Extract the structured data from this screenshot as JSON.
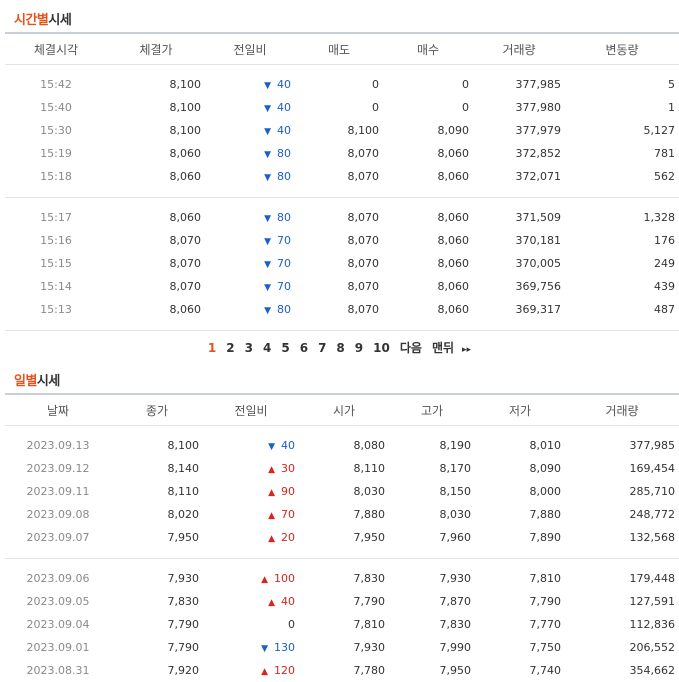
{
  "time_section": {
    "title_accent": "시간별",
    "title_rest": "시세",
    "headers": [
      "체결시각",
      "체결가",
      "전일비",
      "매도",
      "매수",
      "거래량",
      "변동량"
    ],
    "group1": [
      {
        "time": "15:42",
        "price": "8,100",
        "dir": "down",
        "diff": "40",
        "ask": "0",
        "bid": "0",
        "volume": "377,985",
        "change": "5"
      },
      {
        "time": "15:40",
        "price": "8,100",
        "dir": "down",
        "diff": "40",
        "ask": "0",
        "bid": "0",
        "volume": "377,980",
        "change": "1"
      },
      {
        "time": "15:30",
        "price": "8,100",
        "dir": "down",
        "diff": "40",
        "ask": "8,100",
        "bid": "8,090",
        "volume": "377,979",
        "change": "5,127"
      },
      {
        "time": "15:19",
        "price": "8,060",
        "dir": "down",
        "diff": "80",
        "ask": "8,070",
        "bid": "8,060",
        "volume": "372,852",
        "change": "781"
      },
      {
        "time": "15:18",
        "price": "8,060",
        "dir": "down",
        "diff": "80",
        "ask": "8,070",
        "bid": "8,060",
        "volume": "372,071",
        "change": "562"
      }
    ],
    "group2": [
      {
        "time": "15:17",
        "price": "8,060",
        "dir": "down",
        "diff": "80",
        "ask": "8,070",
        "bid": "8,060",
        "volume": "371,509",
        "change": "1,328"
      },
      {
        "time": "15:16",
        "price": "8,070",
        "dir": "down",
        "diff": "70",
        "ask": "8,070",
        "bid": "8,060",
        "volume": "370,181",
        "change": "176"
      },
      {
        "time": "15:15",
        "price": "8,070",
        "dir": "down",
        "diff": "70",
        "ask": "8,070",
        "bid": "8,060",
        "volume": "370,005",
        "change": "249"
      },
      {
        "time": "15:14",
        "price": "8,070",
        "dir": "down",
        "diff": "70",
        "ask": "8,070",
        "bid": "8,060",
        "volume": "369,756",
        "change": "439"
      },
      {
        "time": "15:13",
        "price": "8,060",
        "dir": "down",
        "diff": "80",
        "ask": "8,070",
        "bid": "8,060",
        "volume": "369,317",
        "change": "487"
      }
    ]
  },
  "pager": {
    "pages": [
      "1",
      "2",
      "3",
      "4",
      "5",
      "6",
      "7",
      "8",
      "9",
      "10"
    ],
    "current": "1",
    "next_label": "다음",
    "last_label": "맨뒤",
    "last_icon": "double-chevron-right"
  },
  "daily_section": {
    "title_accent": "일별",
    "title_rest": "시세",
    "headers": [
      "날짜",
      "종가",
      "전일비",
      "시가",
      "고가",
      "저가",
      "거래량"
    ],
    "group1": [
      {
        "date": "2023.09.13",
        "close": "8,100",
        "dir": "down",
        "diff": "40",
        "open": "8,080",
        "high": "8,190",
        "low": "8,010",
        "volume": "377,985"
      },
      {
        "date": "2023.09.12",
        "close": "8,140",
        "dir": "up",
        "diff": "30",
        "open": "8,110",
        "high": "8,170",
        "low": "8,090",
        "volume": "169,454"
      },
      {
        "date": "2023.09.11",
        "close": "8,110",
        "dir": "up",
        "diff": "90",
        "open": "8,030",
        "high": "8,150",
        "low": "8,000",
        "volume": "285,710"
      },
      {
        "date": "2023.09.08",
        "close": "8,020",
        "dir": "up",
        "diff": "70",
        "open": "7,880",
        "high": "8,030",
        "low": "7,880",
        "volume": "248,772"
      },
      {
        "date": "2023.09.07",
        "close": "7,950",
        "dir": "up",
        "diff": "20",
        "open": "7,950",
        "high": "7,960",
        "low": "7,890",
        "volume": "132,568"
      }
    ],
    "group2": [
      {
        "date": "2023.09.06",
        "close": "7,930",
        "dir": "up",
        "diff": "100",
        "open": "7,830",
        "high": "7,930",
        "low": "7,810",
        "volume": "179,448"
      },
      {
        "date": "2023.09.05",
        "close": "7,830",
        "dir": "up",
        "diff": "40",
        "open": "7,790",
        "high": "7,870",
        "low": "7,790",
        "volume": "127,591"
      },
      {
        "date": "2023.09.04",
        "close": "7,790",
        "dir": "flat",
        "diff": "0",
        "open": "7,810",
        "high": "7,830",
        "low": "7,770",
        "volume": "112,836"
      },
      {
        "date": "2023.09.01",
        "close": "7,790",
        "dir": "down",
        "diff": "130",
        "open": "7,930",
        "high": "7,990",
        "low": "7,750",
        "volume": "206,552"
      },
      {
        "date": "2023.08.31",
        "close": "7,920",
        "dir": "up",
        "diff": "120",
        "open": "7,780",
        "high": "7,950",
        "low": "7,740",
        "volume": "354,662"
      }
    ]
  },
  "colors": {
    "accent": "#e4531c",
    "down": "#1a5fcb",
    "up": "#d6261e"
  }
}
